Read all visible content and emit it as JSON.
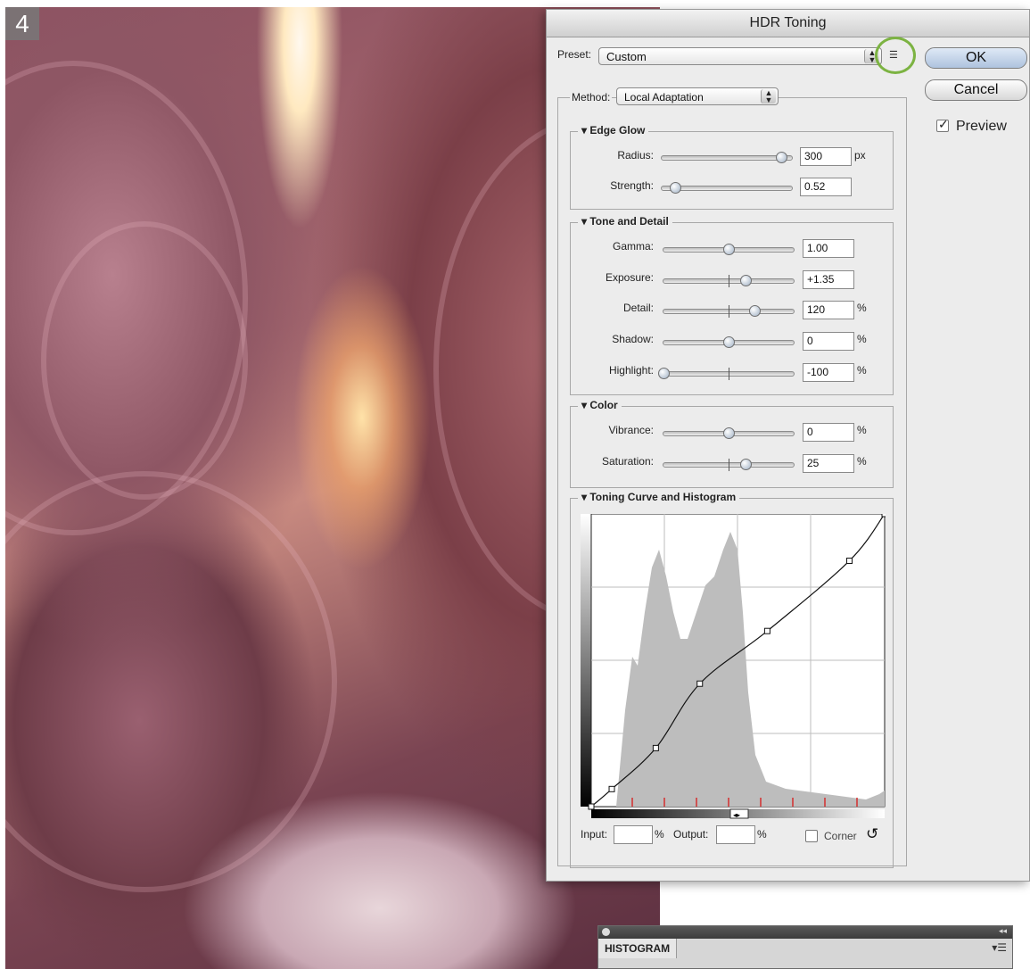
{
  "step_number": "4",
  "dialog": {
    "title": "HDR Toning",
    "preset_label": "Preset:",
    "preset_value": "Custom",
    "ok_label": "OK",
    "cancel_label": "Cancel",
    "preview_label": "Preview",
    "preview_checked": true,
    "method_label": "Method:",
    "method_value": "Local Adaptation"
  },
  "edge_glow": {
    "title": "Edge Glow",
    "radius": {
      "label": "Radius:",
      "value": "300",
      "unit": "px",
      "fraction": 0.92
    },
    "strength": {
      "label": "Strength:",
      "value": "0.52",
      "unit": "",
      "fraction": 0.1
    }
  },
  "tone_detail": {
    "title": "Tone and Detail",
    "gamma": {
      "label": "Gamma:",
      "value": "1.00",
      "unit": "",
      "fraction": 0.5
    },
    "exposure": {
      "label": "Exposure:",
      "value": "+1.35",
      "unit": "",
      "fraction": 0.63
    },
    "detail": {
      "label": "Detail:",
      "value": "120",
      "unit": "%",
      "fraction": 0.7
    },
    "shadow": {
      "label": "Shadow:",
      "value": "0",
      "unit": "%",
      "fraction": 0.5
    },
    "highlight": {
      "label": "Highlight:",
      "value": "-100",
      "unit": "%",
      "fraction": 0.0
    }
  },
  "color": {
    "title": "Color",
    "vibrance": {
      "label": "Vibrance:",
      "value": "0",
      "unit": "%",
      "fraction": 0.5
    },
    "saturation": {
      "label": "Saturation:",
      "value": "25",
      "unit": "%",
      "fraction": 0.63
    }
  },
  "curve": {
    "title": "Toning Curve and Histogram",
    "input_label": "Input:",
    "input_value": "",
    "input_unit": "%",
    "output_label": "Output:",
    "output_value": "",
    "output_unit": "%",
    "corner_label": "Corner",
    "curve_points": [
      [
        0,
        0
      ],
      [
        0.07,
        0.06
      ],
      [
        0.22,
        0.2
      ],
      [
        0.37,
        0.42
      ],
      [
        0.6,
        0.6
      ],
      [
        0.88,
        0.84
      ],
      [
        1,
        1
      ]
    ]
  },
  "histogram_panel": {
    "tab_label": "HISTOGRAM"
  },
  "colors": {
    "highlight_ring": "#7cb342",
    "default_button": "#aec3de"
  }
}
